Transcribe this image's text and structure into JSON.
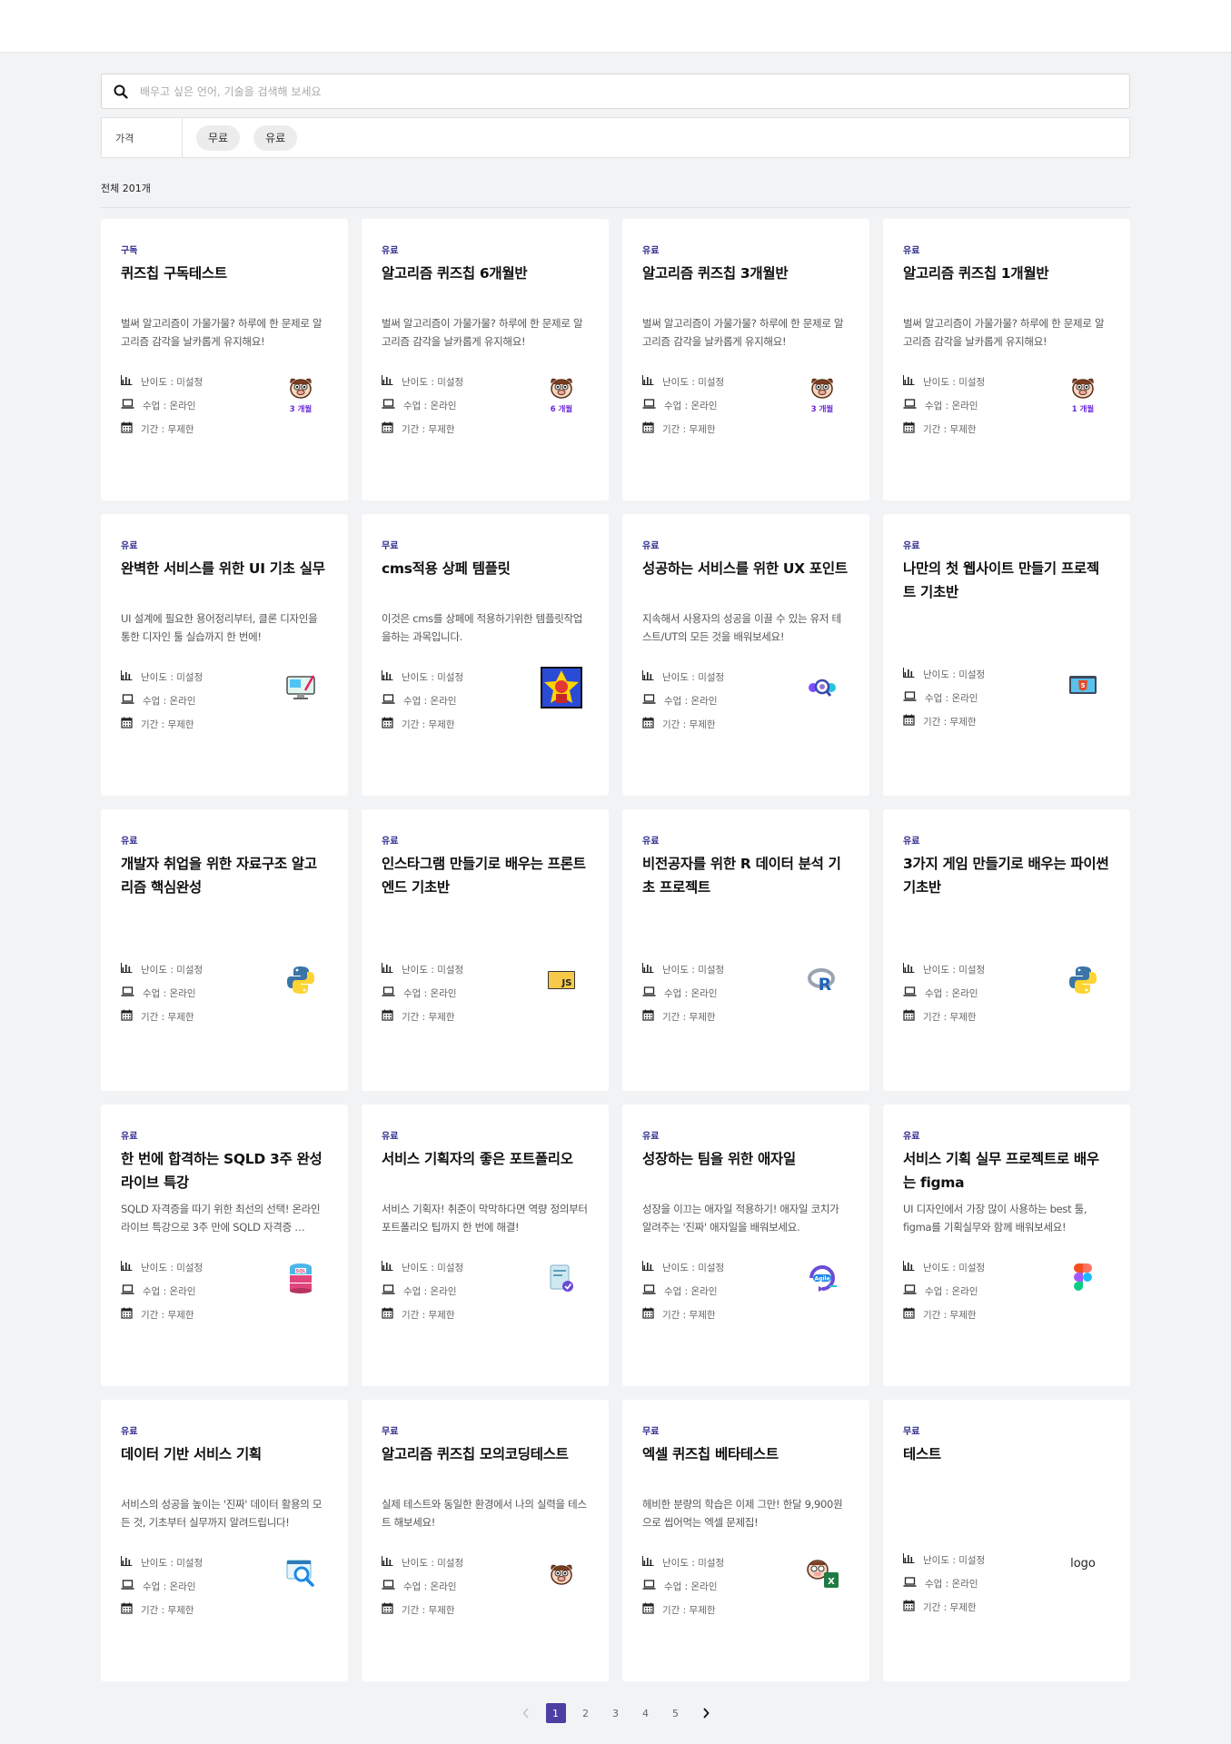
{
  "search": {
    "placeholder": "배우고 싶은 언어, 기술을 검색해 보세요"
  },
  "filter": {
    "label": "가격",
    "chips": [
      "무료",
      "유료"
    ]
  },
  "total": "전체 201개",
  "meta_labels": {
    "difficulty": "난이도 : 미설정",
    "class": "수업 : 온라인",
    "period": "기간 : 무제한"
  },
  "courses": [
    {
      "badge": "구독",
      "title": "퀴즈칩 구독테스트",
      "desc": "벌써 알고리즘이 가물가물? 하루에 한 문제로 알고리즘 감각을 날카롭게 유지해요!",
      "icon": "quiz-mascot-icon",
      "months": "3 개월"
    },
    {
      "badge": "유료",
      "title": "알고리즘 퀴즈칩 6개월반",
      "desc": "벌써 알고리즘이 가물가물? 하루에 한 문제로 알고리즘 감각을 날카롭게 유지해요!",
      "icon": "quiz-mascot-icon",
      "months": "6 개월"
    },
    {
      "badge": "유료",
      "title": "알고리즘 퀴즈칩 3개월반",
      "desc": "벌써 알고리즘이 가물가물? 하루에 한 문제로 알고리즘 감각을 날카롭게 유지해요!",
      "icon": "quiz-mascot-icon",
      "months": "3 개월"
    },
    {
      "badge": "유료",
      "title": "알고리즘 퀴즈칩 1개월반",
      "desc": "벌써 알고리즘이 가물가물? 하루에 한 문제로 알고리즘 감각을 날카롭게 유지해요!",
      "icon": "quiz-mascot-icon",
      "months": "1 개월"
    },
    {
      "badge": "유료",
      "title": "완벽한 서비스를 위한 UI 기초 실무",
      "desc": "UI 설계에 필요한 용어정리부터, 클론 디자인을 통한 디자인 툴 실습까지 한 번에!",
      "icon": "design-monitor-icon",
      "months": ""
    },
    {
      "badge": "무료",
      "title": "cms적용 상페 템플릿",
      "desc": "이것은 cms를 상페에 적용하기위한 템플릿작업을하는 과목입니다.",
      "icon": "superhero-poster-icon",
      "months": ""
    },
    {
      "badge": "유료",
      "title": "성공하는 서비스를 위한 UX 포인트",
      "desc": "지속해서 사용자의 성공을 이끌 수 있는 유저 테스트/UT의 모든 것을 배워보세요!",
      "icon": "ux-research-icon",
      "months": ""
    },
    {
      "badge": "유료",
      "title": "나만의 첫 웹사이트 만들기 프로젝트 기초반",
      "desc": "",
      "icon": "html5-icon",
      "months": ""
    },
    {
      "badge": "유료",
      "title": "개발자 취업을 위한 자료구조 알고리즘 핵심완성",
      "desc": "",
      "icon": "python-icon",
      "months": ""
    },
    {
      "badge": "유료",
      "title": "인스타그램 만들기로 배우는 프론트엔드 기초반",
      "desc": "",
      "icon": "javascript-icon",
      "months": ""
    },
    {
      "badge": "유료",
      "title": "비전공자를 위한 R 데이터 분석 기초 프로젝트",
      "desc": "",
      "icon": "r-language-icon",
      "months": ""
    },
    {
      "badge": "유료",
      "title": "3가지 게임 만들기로 배우는 파이썬 기초반",
      "desc": "",
      "icon": "python-icon",
      "months": ""
    },
    {
      "badge": "유료",
      "title": "한 번에 합격하는 SQLD 3주 완성 라이브 특강",
      "desc": "SQLD 자격증을 따기 위한 최선의 선택! 온라인 라이브 특강으로 3주 만에 SQLD 자격증 …",
      "icon": "sql-database-icon",
      "months": ""
    },
    {
      "badge": "유료",
      "title": "서비스 기획자의 좋은 포트폴리오",
      "desc": "서비스 기획자! 취준이 막막하다면 역량 정의부터 포트폴리오 팁까지 한 번에 해결!",
      "icon": "portfolio-document-icon",
      "months": ""
    },
    {
      "badge": "유료",
      "title": "성장하는 팀을 위한 애자일",
      "desc": "성장을 이끄는 애자일 적용하기! 애자일 코치가 알려주는 '진짜' 애자일을 배워보세요.",
      "icon": "agile-cycle-icon",
      "months": ""
    },
    {
      "badge": "유료",
      "title": "서비스 기획 실무 프로젝트로 배우는 figma",
      "desc": "UI 디자인에서 가장 많이 사용하는 best 툴, figma를 기획실무와 함께 배워보세요!",
      "icon": "figma-icon",
      "months": ""
    },
    {
      "badge": "유료",
      "title": "데이터 기반 서비스 기획",
      "desc": "서비스의 성공을 높이는 '진짜' 데이터 활용의 모든 것, 기초부터 실무까지 알려드립니다!",
      "icon": "data-search-icon",
      "months": ""
    },
    {
      "badge": "무료",
      "title": "알고리즘 퀴즈칩 모의코딩테스트",
      "desc": "실제 테스트와 동일한 환경에서 나의 실력을 테스트 해보세요!",
      "icon": "quiz-mascot-icon",
      "months": ""
    },
    {
      "badge": "무료",
      "title": "엑셀 퀴즈칩 베타테스트",
      "desc": "헤비한 분량의 학습은 이제 그만! 한달 9,900원으로 씹어먹는 엑셀 문제집!",
      "icon": "excel-mascot-icon",
      "months": ""
    },
    {
      "badge": "무료",
      "title": "테스트",
      "desc": "",
      "icon": "broken-logo-image",
      "months": "",
      "alt": "logo"
    }
  ],
  "pagination": {
    "prev": "‹",
    "pages": [
      "1",
      "2",
      "3",
      "4",
      "5"
    ],
    "active": "1",
    "next": "›"
  },
  "colors": {
    "accent": "#4b3fa3",
    "badge": "#2e2a8c",
    "months": "#6b2ad8"
  }
}
